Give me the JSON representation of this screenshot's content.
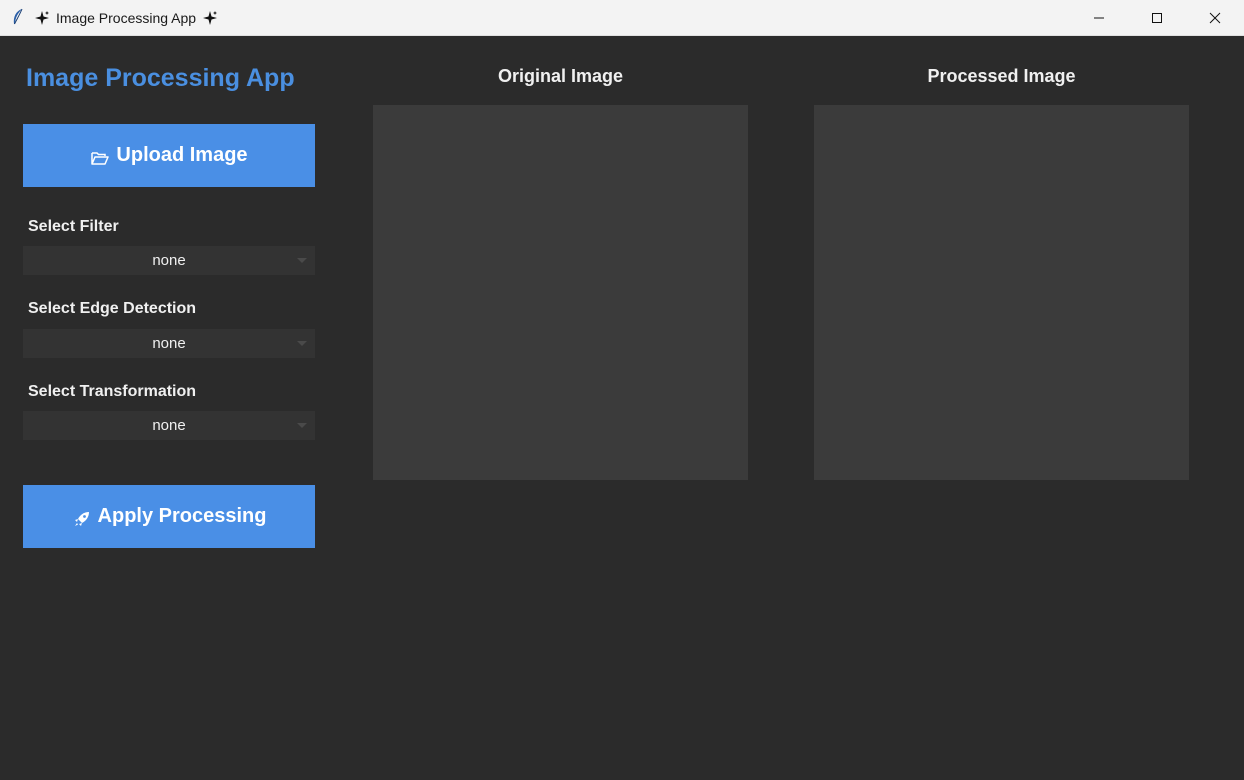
{
  "window": {
    "title": "Image Processing App",
    "icons": {
      "app": "feather-icon",
      "title_left": "sparkle-icon",
      "title_right": "sparkle-icon"
    },
    "controls": [
      "minimize-icon",
      "maximize-icon",
      "close-icon"
    ]
  },
  "sidebar": {
    "heading": "Image Processing App",
    "upload_button": {
      "label": "Upload Image",
      "icon": "folder-open-icon"
    },
    "filter": {
      "label": "Select Filter",
      "value": "none"
    },
    "edge": {
      "label": "Select Edge Detection",
      "value": "none"
    },
    "transform": {
      "label": "Select Transformation",
      "value": "none"
    },
    "apply_button": {
      "label": "Apply Processing",
      "icon": "rocket-icon"
    }
  },
  "panels": {
    "original": {
      "title": "Original Image"
    },
    "processed": {
      "title": "Processed Image"
    }
  },
  "colors": {
    "accent": "#4a8fe6",
    "background": "#2b2b2b",
    "panel": "#3b3b3b",
    "select": "#333333",
    "titlebar": "#f3f3f3"
  }
}
